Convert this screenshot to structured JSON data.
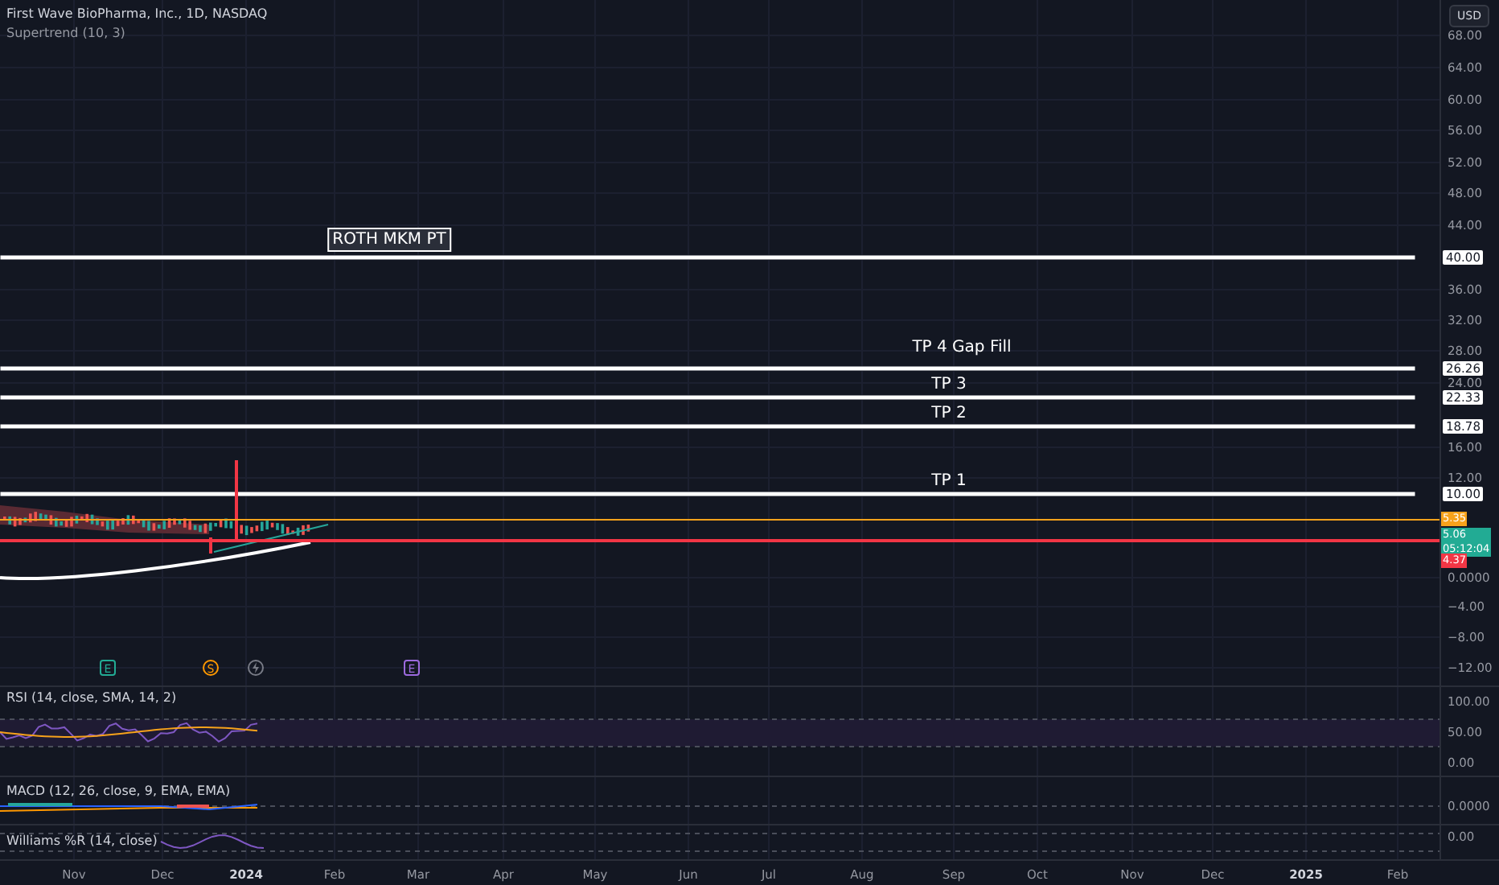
{
  "header": {
    "title": "First Wave BioPharma, Inc., 1D, NASDAQ",
    "indicator": "Supertrend (10, 3)"
  },
  "currency_button": "USD",
  "price_scale": [
    "68.00",
    "64.00",
    "60.00",
    "56.00",
    "52.00",
    "48.00",
    "44.00",
    "36.00",
    "32.00",
    "28.00",
    "24.00",
    "16.00",
    "12.00",
    "0.0000",
    "−4.00",
    "−8.00",
    "−12.00"
  ],
  "levels": [
    {
      "label": "ROTH MKM PT",
      "tag": "40.00",
      "kind": "boxed"
    },
    {
      "label": "TP 4 Gap Fill",
      "tag": "26.26",
      "kind": "plain"
    },
    {
      "label": "TP 3",
      "tag": "22.33",
      "kind": "plain"
    },
    {
      "label": "TP 2",
      "tag": "18.78",
      "kind": "plain"
    },
    {
      "label": "TP 1",
      "tag": "10.00",
      "kind": "plain"
    }
  ],
  "price_tags": [
    {
      "text": "5.35",
      "color": "#f7a21b"
    },
    {
      "text": "5.06",
      "subtext": "05:12:04",
      "color": "#22ab94"
    },
    {
      "text": "4.37",
      "color": "#f23645"
    }
  ],
  "events": [
    {
      "kind": "earnings",
      "text": "E",
      "color": "#22ab94"
    },
    {
      "kind": "split",
      "text": "S",
      "color": "#ff9800"
    },
    {
      "kind": "news",
      "color": "#787b86"
    },
    {
      "kind": "earnings",
      "text": "E",
      "color": "#9c6ade"
    }
  ],
  "panes": [
    {
      "title": "RSI (14, close, SMA, 14, 2)",
      "scale": [
        "100.00",
        "50.00",
        "0.00"
      ]
    },
    {
      "title": "MACD (12, 26, close, 9, EMA, EMA)",
      "scale": [
        "0.0000"
      ]
    },
    {
      "title": "Williams %R (14, close)",
      "scale": [
        "0.00"
      ]
    }
  ],
  "time_axis": [
    {
      "label": "Nov",
      "kind": "month"
    },
    {
      "label": "Dec",
      "kind": "month"
    },
    {
      "label": "2024",
      "kind": "year"
    },
    {
      "label": "Feb",
      "kind": "month"
    },
    {
      "label": "Mar",
      "kind": "month"
    },
    {
      "label": "Apr",
      "kind": "month"
    },
    {
      "label": "May",
      "kind": "month"
    },
    {
      "label": "Jun",
      "kind": "month"
    },
    {
      "label": "Jul",
      "kind": "month"
    },
    {
      "label": "Aug",
      "kind": "month"
    },
    {
      "label": "Sep",
      "kind": "month"
    },
    {
      "label": "Oct",
      "kind": "month"
    },
    {
      "label": "Nov",
      "kind": "month"
    },
    {
      "label": "Dec",
      "kind": "month"
    },
    {
      "label": "2025",
      "kind": "year"
    },
    {
      "label": "Feb",
      "kind": "month"
    }
  ]
}
